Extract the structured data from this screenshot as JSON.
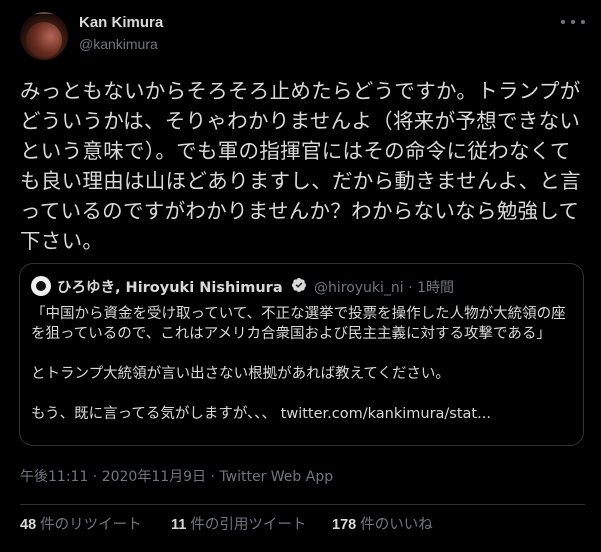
{
  "author": {
    "name": "Kan Kimura",
    "handle": "@kankimura"
  },
  "tweet": {
    "text": "みっともないからそろそろ止めたらどうですか。トランプがどういうかは、そりゃわかりませんよ（将来が予想できないという意味で）。でも軍の指揮官にはその命令に従わなくても良い理由は山ほどありますし、だから動きませんよ、と言っているのですがわかりませんか？わからないなら勉強して下さい。"
  },
  "quoted_tweet": {
    "author_name": "ひろゆき, Hiroyuki Nishimura",
    "handle": "@hiroyuki_ni",
    "separator": "·",
    "time_ago": "1時間",
    "paragraphs": [
      "「中国から資金を受け取っていて、不正な選挙で投票を操作した人物が大統領の座を狙っているので、これはアメリカ合衆国および民主主義に対する攻撃である」",
      "とトランプ大統領が言い出さない根拠があれば教えてください。",
      "もう、既に言ってる気がしますが、、、 twitter.com/kankimura/stat..."
    ]
  },
  "meta": {
    "timestamp": "午後11:11 · 2020年11月9日 · Twitter Web App"
  },
  "stats": {
    "retweets_count": "48",
    "retweets_label": "件のリツイート",
    "quotes_count": "11",
    "quotes_label": "件の引用ツイート",
    "likes_count": "178",
    "likes_label": "件のいいね"
  },
  "colors": {
    "background": "#000000",
    "text": "#d9d9d9",
    "secondary": "#6e767d",
    "border": "#2f3336",
    "verified": "#1da1f2"
  }
}
